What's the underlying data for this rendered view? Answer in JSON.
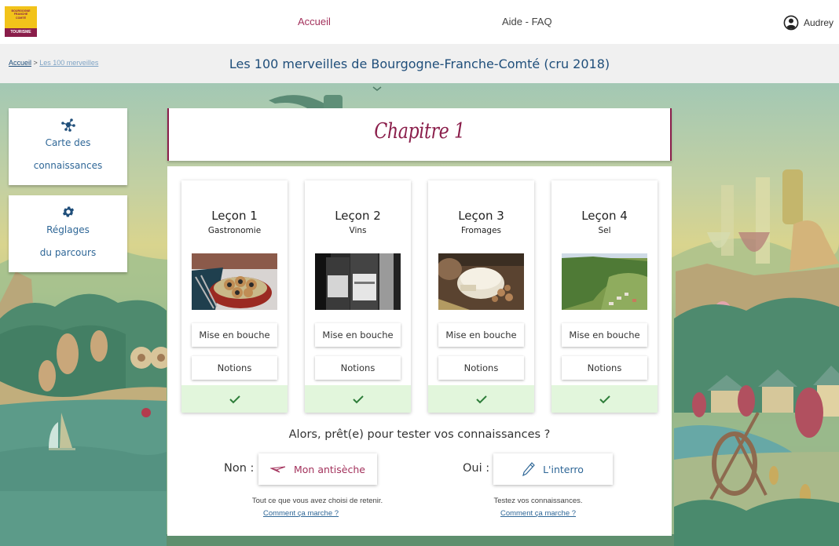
{
  "topbar": {
    "logo": {
      "line1": "BOURGOGNE",
      "line2": "FRANCHE",
      "line3": "COMTÉ",
      "bottom": "TOURISME"
    },
    "nav": {
      "home": "Accueil",
      "faq": "Aide - FAQ"
    },
    "user": {
      "name": "Audrey",
      "icon": "user-circle-icon"
    }
  },
  "subbar": {
    "breadcrumb": {
      "home": "Accueil",
      "separator": " > ",
      "current": "Les 100 merveilles"
    },
    "title": "Les 100 merveilles de Bourgogne-Franche-Comté (cru 2018)"
  },
  "sidebar": {
    "map": {
      "icon": "network-icon",
      "line1": "Carte des",
      "line2": "connaissances"
    },
    "settings": {
      "icon": "gear-icon",
      "line1": "Réglages",
      "line2": "du parcours"
    }
  },
  "chapter": {
    "title": "Chapitre 1"
  },
  "lessons": [
    {
      "title": "Leçon 1",
      "subtitle": "Gastronomie",
      "image": "escargots-photo",
      "btn1": "Mise en bouche",
      "btn2": "Notions",
      "completed": true
    },
    {
      "title": "Leçon 2",
      "subtitle": "Vins",
      "image": "wine-bottles-photo",
      "btn1": "Mise en bouche",
      "btn2": "Notions",
      "completed": true
    },
    {
      "title": "Leçon 3",
      "subtitle": "Fromages",
      "image": "mont-dor-cheese-photo",
      "btn1": "Mise en bouche",
      "btn2": "Notions",
      "completed": true
    },
    {
      "title": "Leçon 4",
      "subtitle": "Sel",
      "image": "salins-valley-photo",
      "btn1": "Mise en bouche",
      "btn2": "Notions",
      "completed": true
    }
  ],
  "quiz": {
    "question": "Alors, prêt(e) pour tester vos connaissances ?",
    "no": {
      "label": "Non :",
      "button": "Mon antisèche",
      "icon": "paper-plane-icon",
      "desc": "Tout ce que vous avez choisi de retenir.",
      "link": "Comment ça marche ?"
    },
    "yes": {
      "label": "Oui :",
      "button": "L'interro",
      "icon": "pencil-icon",
      "desc": "Testez vos connaissances.",
      "link": "Comment ça marche ?"
    }
  },
  "colors": {
    "brand_burgundy": "#8a1d4a",
    "brand_yellow": "#f2c31a",
    "link_blue": "#2f6797",
    "title_blue": "#1f4e7a",
    "accent_pink": "#a3325c",
    "done_green_bg": "#e2f6dc",
    "check_green": "#2e7d3a"
  }
}
